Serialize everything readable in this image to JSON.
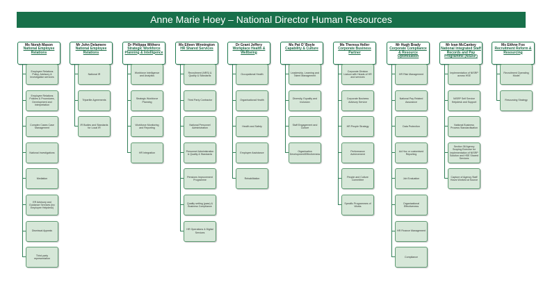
{
  "title": "Anne Marie Hoey – National Director Human Resources",
  "colors": {
    "banner": "#18704a",
    "box_fill": "#d6e7d8",
    "box_border": "#5f9a72",
    "head_border": "#1f7a4f",
    "line": "#2e7d55"
  },
  "columns": [
    {
      "name": "Ms Norah Mason",
      "title": "National Employee Relations",
      "items": [
        "Employee Relations Policy, Advisory & Investigation services",
        "Employee Relations Policies & Procedures, Development and Interpretation",
        "Complex Cases Case Management",
        "National Investigations",
        "Mediation",
        "ER Advisory and Guidance Services (inc Employee Helpdesk)",
        "Dismissal Appeals",
        "Third party representation"
      ]
    },
    {
      "name": "Mr John Delamere",
      "title": "National Employee Relations",
      "items": [
        "National IR",
        "Tripartite Agreements",
        "IR Bodies and Standards for Local IR"
      ]
    },
    {
      "name": "Dr Philippa Withero",
      "title": "Strategic Workforce Planning & Intelligence",
      "items": [
        "Workforce Intelligence and Analytics",
        "Strategic Workforce Planning",
        "Workforce Monitoring and Reporting",
        "HR Integration"
      ]
    },
    {
      "name": "Ms Eileen Winnington",
      "title": "HR Shared Services",
      "items": [
        "Recruitment (NRS) & Quality & Standards",
        "Third Party Contractor",
        "National Personnel Administration",
        "Personnel Administration & Quality & Standards",
        "Pensions Improvement Programme",
        "Quality setting (pass) & Business Compliance",
        "HR Operations & Digital Services"
      ]
    },
    {
      "name": "Dr Grant Jeffery",
      "title": "Workplace Health & Wellbeing",
      "items": [
        "Occupational Health",
        "Organisational Health",
        "Health and Safety",
        "Employee Assistance",
        "Rehabilitation"
      ]
    },
    {
      "name": "Ms Pat O’ Boyle",
      "title": "Capability & Culture",
      "items": [
        "Leadership, Learning and Talent Management",
        "Diversity, Equality and Inclusion",
        "Staff Engagement and Culture",
        "Organisation Development/Effectiveness"
      ]
    },
    {
      "name": "Ms Theresa Heller",
      "title": "Corporate Business Partner",
      "items": [
        "Corporate Division Liaison with Heads of HR and services",
        "Corporate Business Advisory Service",
        "HR People Strategy",
        "Performance Achievement",
        "People and Culture Committee",
        "Specific Programmes of Works"
      ]
    },
    {
      "name": "Mr Hugh Brady",
      "title": "Corporate Compliance & Resource Optimisation",
      "items": [
        "HR Risk Management",
        "National Pay Related Assurance",
        "Data Protection",
        "Ad Hoc or customised Reporting",
        "Job Evaluation",
        "Organisational Effectiveness",
        "HR Finance Management",
        "Compliance"
      ]
    },
    {
      "name": "Mr Ivan McCankey",
      "title": "National Integrated Staff Records and Pay Programme (NISRP)",
      "items": [
        "Implementation of NISRP across HSE",
        "NISRP Self Service Helpdesk and Support",
        "National Business Process Standardisation",
        "Section 38 Agency Scoping Exercise for implementation of NISRP Solution and HSE Shared Services",
        "Capture of Agency Staff Hours Worked at Source"
      ]
    },
    {
      "name": "Ms Eithne Fox",
      "title": "Recruitment Reform & Resourcing",
      "items": [
        "Recruitment Operating Model",
        "Resourcing Strategy"
      ]
    }
  ]
}
